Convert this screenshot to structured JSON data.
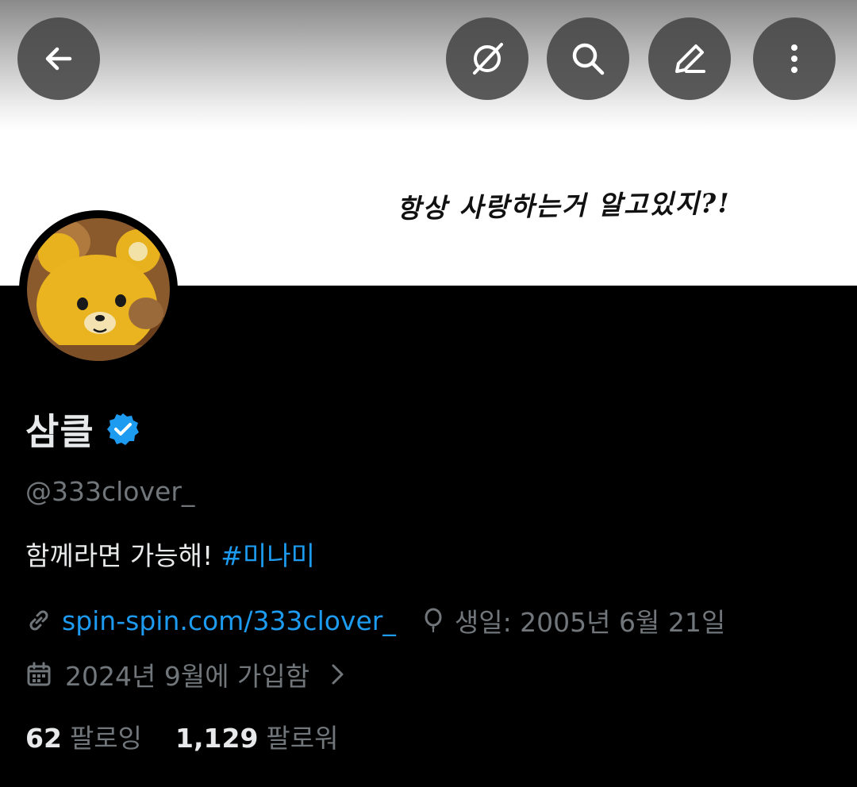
{
  "banner": {
    "handwritten_text": "항상 사랑하는거 알고있지?!"
  },
  "toolbar": {
    "back": "arrow-left-icon",
    "grok": "grok-icon",
    "search": "search-icon",
    "edit": "edit-icon",
    "more": "more-vertical-icon"
  },
  "profile": {
    "name": "삼클",
    "handle": "@333clover_",
    "bio_text": "함께라면 가능해!",
    "bio_hashtag": "#미나미",
    "link": "spin-spin.com/333clover_",
    "birthday": "생일: 2005년 6월 21일",
    "joined": "2024년 9월에 가입함",
    "following_count": "62",
    "following_label": "팔로잉",
    "followers_count": "1,129",
    "followers_label": "팔로워"
  },
  "colors": {
    "accent": "#1d9bf0",
    "text": "#e7e9ea",
    "muted": "#71767b",
    "background": "#000000"
  }
}
